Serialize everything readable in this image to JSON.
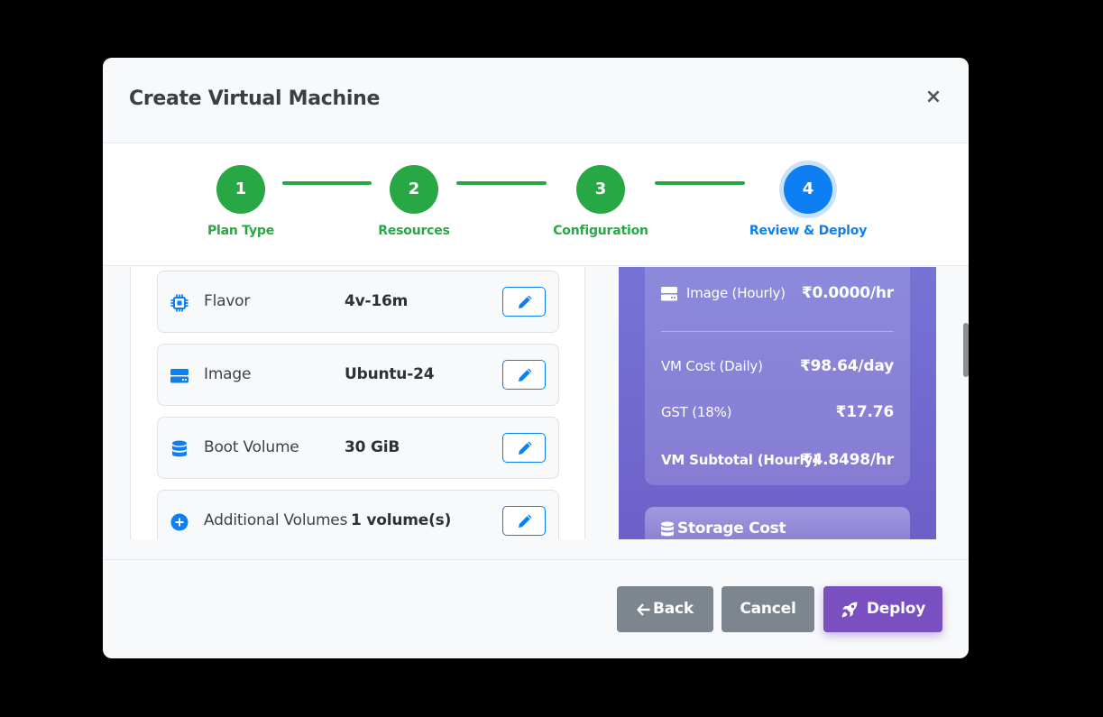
{
  "modal": {
    "title": "Create Virtual Machine",
    "close_symbol": "×"
  },
  "steps": [
    {
      "number": "1",
      "label": "Plan Type",
      "state": "complete"
    },
    {
      "number": "2",
      "label": "Resources",
      "state": "complete"
    },
    {
      "number": "3",
      "label": "Configuration",
      "state": "complete"
    },
    {
      "number": "4",
      "label": "Review & Deploy",
      "state": "active"
    }
  ],
  "summary": {
    "rows": [
      {
        "label": "Flavor",
        "value": "4v-16m",
        "icon": "cpu-icon"
      },
      {
        "label": "Image",
        "value": "Ubuntu-24",
        "icon": "server-icon"
      },
      {
        "label": "Boot Volume",
        "value": "30 GiB",
        "icon": "database-icon"
      },
      {
        "label": "Additional Volumes",
        "value": "1 volume(s)",
        "icon": "plus-circle-icon"
      }
    ]
  },
  "cost": {
    "image_hourly": {
      "label": "Image (Hourly)",
      "value": "₹0.0000/hr"
    },
    "vm_daily": {
      "label": "VM Cost (Daily)",
      "value": "₹98.64/day"
    },
    "gst": {
      "label": "GST (18%)",
      "value": "₹17.76"
    },
    "vm_subtotal": {
      "label": "VM Subtotal (Hourly)",
      "value": "₹4.8498/hr"
    },
    "storage_title": "Storage Cost"
  },
  "footer": {
    "back_label": "Back",
    "cancel_label": "Cancel",
    "deploy_label": "Deploy"
  },
  "colors": {
    "success": "#28a745",
    "primary": "#0d7ff2",
    "deploy": "#7a4fc0",
    "secondary": "#7d868e"
  }
}
